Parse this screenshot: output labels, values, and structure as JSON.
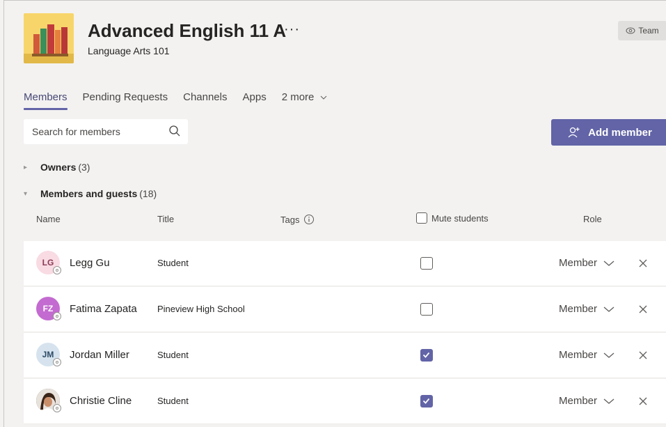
{
  "team": {
    "name": "Advanced English 11 A",
    "more": "···",
    "subtitle": "Language Arts 101",
    "pill_label": "Team"
  },
  "tabs": [
    {
      "label": "Members"
    },
    {
      "label": "Pending Requests"
    },
    {
      "label": "Channels"
    },
    {
      "label": "Apps"
    },
    {
      "label": "2 more"
    }
  ],
  "search": {
    "placeholder": "Search for members"
  },
  "add_member": {
    "label": "Add member"
  },
  "owners": {
    "label": "Owners",
    "count": "(3)"
  },
  "members_section": {
    "label": "Members and guests",
    "count": "(18)"
  },
  "columns": {
    "name": "Name",
    "title": "Title",
    "tags": "Tags",
    "mute": "Mute students",
    "role": "Role"
  },
  "members": [
    {
      "initials": "LG",
      "name": "Legg Gu",
      "title": "Student",
      "muted": false,
      "role": "Member",
      "avatar_bg": "#f9dbe4",
      "avatar_fg": "#8a3a55"
    },
    {
      "initials": "FZ",
      "name": "Fatima Zapata",
      "title": "Pineview High School",
      "muted": false,
      "role": "Member",
      "avatar_bg": "#c36bd0",
      "avatar_fg": "#ffffff"
    },
    {
      "initials": "JM",
      "name": "Jordan Miller",
      "title": "Student",
      "muted": true,
      "role": "Member",
      "avatar_bg": "#d6e3ee",
      "avatar_fg": "#2c4a66"
    },
    {
      "initials": "",
      "name": "Christie Cline",
      "title": "Student",
      "muted": true,
      "role": "Member",
      "avatar_bg": "#5a3a2a",
      "avatar_fg": "#ffffff"
    }
  ],
  "colors": {
    "accent": "#6264a7",
    "background": "#f3f2f1"
  }
}
